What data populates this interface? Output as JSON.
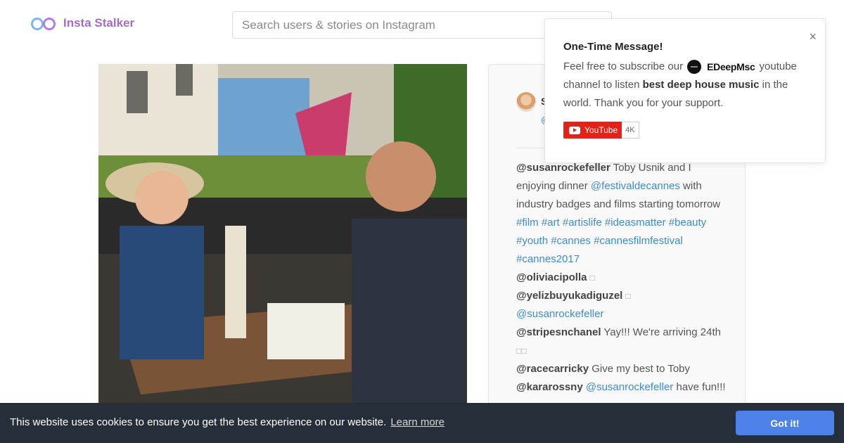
{
  "header": {
    "logo_text": "Insta Stalker",
    "search_placeholder": "Search users & stories on Instagram"
  },
  "post": {
    "photo_alt": "Two people toasting with rosé wine at a cafe table",
    "author_initial": "S",
    "author_handle_initial": "@",
    "comments": [
      {
        "user": "@susanrockefeller",
        "text": "Toby Usnik and I enjoying dinner ",
        "mention": "@festivaldecannes",
        "text2": " with industry badges and films starting tomorrow ",
        "tags": "#film #art #artislife #ideasmatter #beauty #youth #cannes #cannesfilmfestival #cannes2017"
      },
      {
        "user": "@oliviacipolla",
        "glyph": "□"
      },
      {
        "user": "@yelizbuyukadiguzel",
        "glyph": "□",
        "mention": "@susanrockefeller"
      },
      {
        "user": "@stripesnchanel",
        "text": "Yay!!! We're arriving 24th",
        "glyph": "□□"
      },
      {
        "user": "@racecarricky",
        "text": "Give my best to Toby"
      },
      {
        "user": "@kararossny",
        "mention": "@susanrockefeller",
        "text2": "have fun!!!"
      }
    ]
  },
  "popup": {
    "title": "One-Time Message!",
    "line1": "Feel free to subscribe our",
    "channel_name": "EDeepMsc",
    "line1_end": "youtube channel to listen",
    "bold_text": "best deep house music",
    "line2_end": "in the world. Thank you for your support.",
    "close": "×",
    "yt_label": "YouTube",
    "yt_count": "4K"
  },
  "cookie": {
    "message": "This website uses cookies to ensure you get the best experience on our website.",
    "learn_more": "Learn more",
    "button": "Got it!"
  },
  "colors": {
    "accent_purple": "#a36cc9",
    "link_blue": "#3d8bd1",
    "cookie_bg": "#252e39",
    "cookie_button": "#4b81e8",
    "youtube_red": "#e62117"
  }
}
